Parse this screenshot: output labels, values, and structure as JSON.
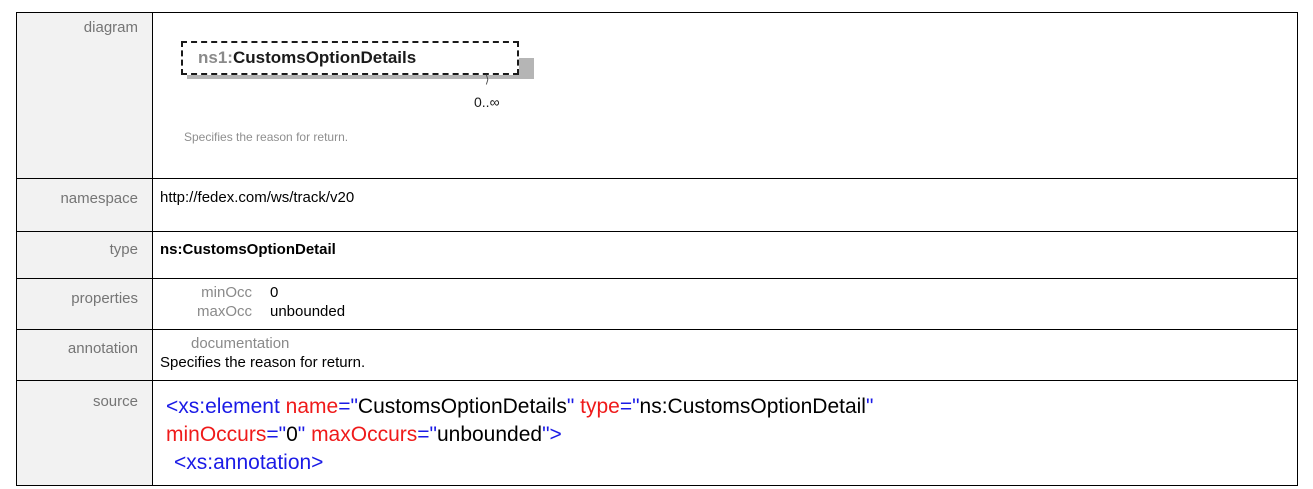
{
  "rows": {
    "diagram": {
      "label": "diagram",
      "element_prefix": "ns1:",
      "element_name": "CustomsOptionDetails",
      "occurrence": "0..∞",
      "doc": "Specifies the reason for return."
    },
    "namespace": {
      "label": "namespace",
      "value": "http://fedex.com/ws/track/v20"
    },
    "type": {
      "label": "type",
      "value": "ns:CustomsOptionDetail"
    },
    "properties": {
      "label": "properties",
      "items": [
        {
          "key": "minOcc",
          "value": "0"
        },
        {
          "key": "maxOcc",
          "value": "unbounded"
        }
      ]
    },
    "annotation": {
      "label": "annotation",
      "key": "documentation",
      "value": "Specifies the reason for return."
    },
    "source": {
      "label": "source",
      "line1_open": "<xs:element ",
      "line1_attr1": "name",
      "line1_eq1": "=\"",
      "line1_val1": "CustomsOptionDetails",
      "line1_q1": "\" ",
      "line1_attr2": "type",
      "line1_eq2": "=\"",
      "line1_val2": "ns:CustomsOptionDetail",
      "line1_q2": "\"",
      "line2_attr1": "minOccurs",
      "line2_eq1": "=\"",
      "line2_val1": "0",
      "line2_q1": "\" ",
      "line2_attr2": "maxOccurs",
      "line2_eq2": "=\"",
      "line2_val2": "unbounded",
      "line2_q2": "\">",
      "line3": "<xs:annotation>"
    }
  }
}
